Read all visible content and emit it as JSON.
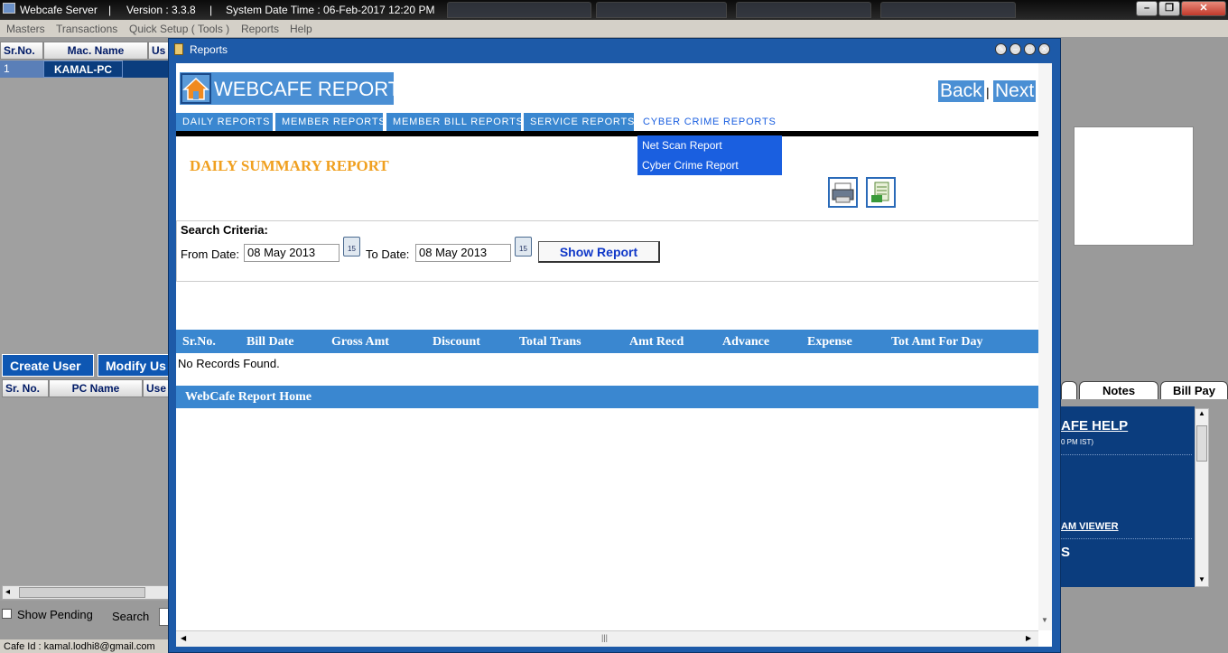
{
  "titlebar": {
    "app_name": "Webcafe Server",
    "sep1": "|",
    "version": "Version : 3.3.8",
    "sep2": "|",
    "datetime": "System Date Time : 06-Feb-2017 12:20 PM"
  },
  "menu": [
    "Masters",
    "Transactions",
    "Quick Setup ( Tools )",
    "Reports",
    "Help"
  ],
  "left_grid": {
    "headers": [
      "Sr.No.",
      "Mac. Name",
      "Us"
    ],
    "row": {
      "sr": "1",
      "mac": "KAMAL-PC"
    }
  },
  "user_buttons": {
    "create": "Create User",
    "modify": "Modify Us"
  },
  "left_grid2": {
    "headers": [
      "Sr. No.",
      "PC Name",
      "Use"
    ]
  },
  "bottom_left": {
    "show_pending": "Show Pending",
    "search": "Search",
    "cafe_id": "Cafe Id : kamal.lodhi8@gmail.com"
  },
  "right_tabs": {
    "notes": "Notes",
    "bill_pay": "Bill Pay"
  },
  "help_panel": {
    "title": "AFE HELP",
    "time": "0 PM IST)",
    "link": "AM VIEWER",
    "s": "S"
  },
  "reports_window": {
    "title": "Reports",
    "header_title": "WEBCAFE REPORTS",
    "back": "Back",
    "pipe": "|",
    "next": "Next",
    "tabs": [
      "DAILY REPORTS",
      "MEMBER REPORTS",
      "MEMBER BILL REPORTS",
      "SERVICE REPORTS",
      "CYBER CRIME REPORTS"
    ],
    "dropdown": [
      "Net Scan Report",
      "Cyber Crime Report"
    ],
    "report_title": "DAILY SUMMARY REPORT",
    "criteria": {
      "heading": "Search Criteria:",
      "from_label": "From Date:",
      "from_value": "08 May 2013",
      "to_label": "To Date:",
      "to_value": "08 May 2013",
      "calendar_day": "15",
      "show_button": "Show Report"
    },
    "table": {
      "headers": [
        "Sr.No.",
        "Bill Date",
        "Gross Amt",
        "Discount",
        "Total Trans",
        "Amt Recd",
        "Advance",
        "Expense",
        "Tot Amt For Day"
      ],
      "empty_text": "No Records Found."
    },
    "home_bar": "WebCafe Report Home"
  },
  "colors": {
    "accent": "#3a87d0",
    "window": "#1d5aa8",
    "dropdown": "#1a5fe0",
    "report_title": "#f0a020"
  }
}
